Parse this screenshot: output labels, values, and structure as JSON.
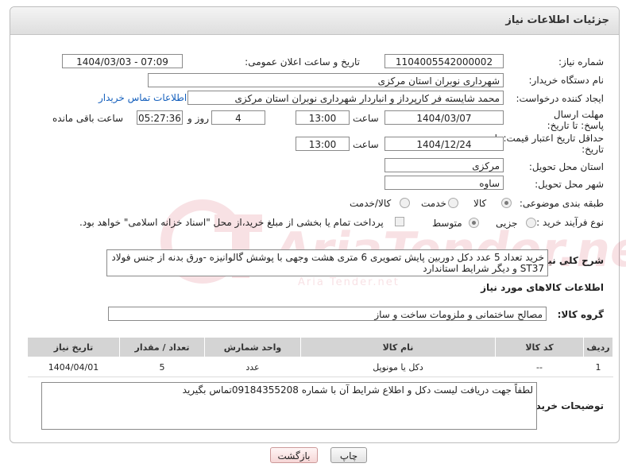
{
  "header": {
    "title": "جزئیات اطلاعات نیاز"
  },
  "labels": {
    "need_number": "شماره نیاز:",
    "announce_datetime": "تاریخ و ساعت اعلان عمومی:",
    "buyer_org": "نام دستگاه خریدار:",
    "requester": "ایجاد کننده درخواست:",
    "reply_deadline": "مهلت ارسال پاسخ: تا تاریخ:",
    "price_validity": "حداقل تاریخ اعتبار قیمت: تا تاریخ:",
    "time": "ساعت",
    "day_and": "روز و",
    "remaining": "ساعت باقی مانده",
    "province": "استان محل تحویل:",
    "city": "شهر محل تحویل:",
    "category": "طبقه بندی موضوعی:",
    "process_type": "نوع فرآیند خرید :",
    "description": "شرح کلی نیاز:",
    "goods_info": "اطلاعات کالاهای مورد نیاز",
    "goods_group": "گروه کالا:",
    "buyer_notes": "توضیحات خریدار:"
  },
  "values": {
    "need_number": "1104005542000002",
    "announce_datetime": "1404/03/03 - 07:09",
    "buyer_org": "شهرداری نوبران استان مرکزی",
    "requester": "محمد شایسته فر کارپرداز و انباردار شهرداری نوبران استان مرکزی",
    "contact_link": "اطلاعات تماس خریدار",
    "reply_date": "1404/03/07",
    "reply_time": "13:00",
    "days": "4",
    "remaining_time": "05:27:36",
    "validity_date": "1404/12/24",
    "validity_time": "13:00",
    "province": "مرکزی",
    "city": "ساوه",
    "description": "خرید تعداد 5 عدد دکل دوربین پایش تصویری 6 متری هشت وجهی با پوشش گالوانیزه  -ورق بدنه از جنس فولاد ST37 و دیگر شرایط استاندارد",
    "goods_group": "مصالح ساختمانی و ملزومات ساخت و ساز",
    "buyer_notes": "لطفاً جهت دریافت لیست دکل و اطلاع شرایط آن  با شماره 09184355208تماس بگیرید"
  },
  "category_options": {
    "goods": "کالا",
    "service": "خدمت",
    "goods_service": "کالا/خدمت"
  },
  "process_options": {
    "partial": "جزیی",
    "medium": "متوسط",
    "treasury_note": "پرداخت تمام یا بخشی از مبلغ خرید،از محل \"اسناد خزانه اسلامی\" خواهد بود."
  },
  "table": {
    "headers": [
      "ردیف",
      "کد کالا",
      "نام کالا",
      "واحد شمارش",
      "تعداد / مقدار",
      "تاریخ نیاز"
    ],
    "rows": [
      [
        "1",
        "--",
        "دکل یا مونوپل",
        "عدد",
        "5",
        "1404/04/01"
      ]
    ]
  },
  "buttons": {
    "print": "چاپ",
    "back": "بازگشت"
  },
  "watermark": {
    "text": "AriaTender.neT",
    "sub": "Aria Tender.net"
  }
}
